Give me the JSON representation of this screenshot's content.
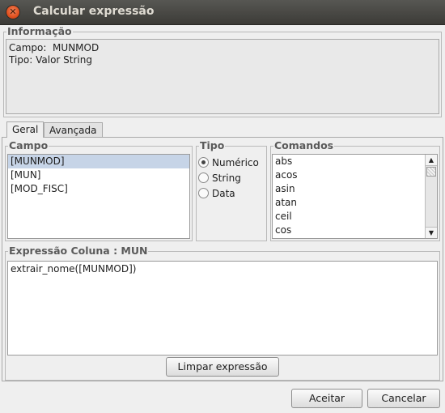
{
  "window": {
    "title": "Calcular expressão"
  },
  "info": {
    "legend": "Informação",
    "line1": "Campo:  MUNMOD",
    "line2": "Tipo: Valor String"
  },
  "tabs": [
    {
      "label": "Geral"
    },
    {
      "label": "Avançada"
    }
  ],
  "campo": {
    "legend": "Campo",
    "items": [
      "[MUNMOD]",
      "[MUN]",
      "[MOD_FISC]"
    ],
    "selected": "[MUNMOD]"
  },
  "tipo": {
    "legend": "Tipo",
    "options": [
      "Numérico",
      "String",
      "Data"
    ],
    "selected": "Numérico"
  },
  "comandos": {
    "legend": "Comandos",
    "items": [
      "abs",
      "acos",
      "asin",
      "atan",
      "ceil",
      "cos"
    ]
  },
  "expressao": {
    "legend": "Expressão Coluna : MUN",
    "value": "extrair_nome([MUNMOD])",
    "clear_label": "Limpar expressão"
  },
  "buttons": {
    "accept": "Aceitar",
    "cancel": "Cancelar"
  }
}
